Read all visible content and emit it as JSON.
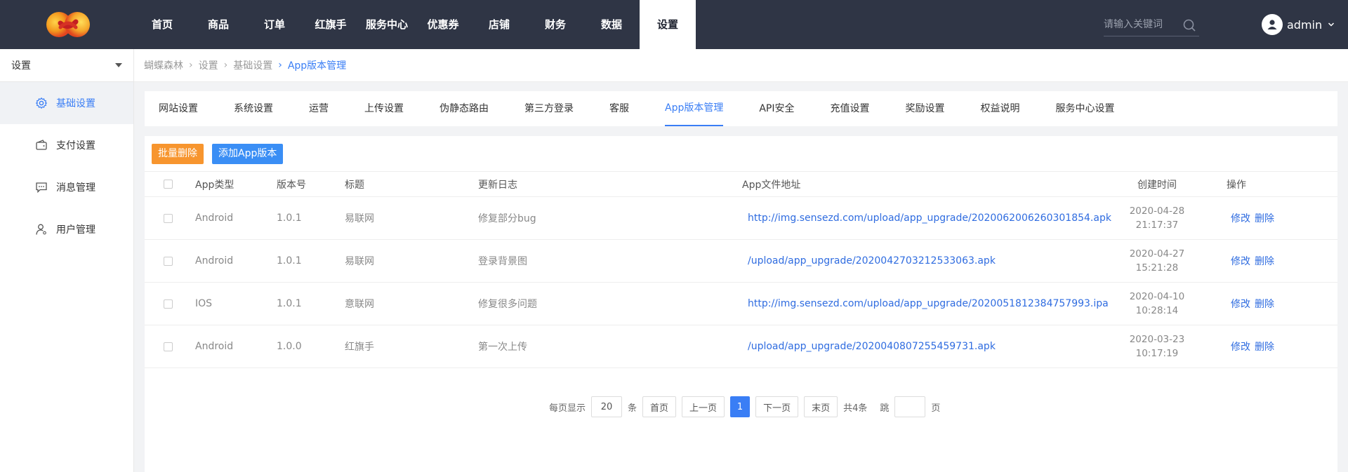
{
  "header": {
    "nav": [
      "首页",
      "商品",
      "订单",
      "红旗手",
      "服务中心",
      "优惠券",
      "店铺",
      "财务",
      "数据",
      "设置"
    ],
    "active_nav": "设置",
    "search_placeholder": "请输入关键词",
    "username": "admin"
  },
  "sidebar": {
    "select_label": "设置",
    "items": [
      {
        "label": "基础设置",
        "icon": "gear-icon",
        "active": true
      },
      {
        "label": "支付设置",
        "icon": "wallet-icon"
      },
      {
        "label": "消息管理",
        "icon": "message-icon"
      },
      {
        "label": "用户管理",
        "icon": "user-icon"
      }
    ]
  },
  "breadcrumb": [
    "蝴蝶森林",
    "设置",
    "基础设置",
    "App版本管理"
  ],
  "tabs": [
    "网站设置",
    "系统设置",
    "运营",
    "上传设置",
    "伪静态路由",
    "第三方登录",
    "客服",
    "App版本管理",
    "API安全",
    "充值设置",
    "奖励设置",
    "权益说明",
    "服务中心设置"
  ],
  "active_tab": "App版本管理",
  "toolbar": {
    "batch_delete": "批量删除",
    "add_version": "添加App版本"
  },
  "table": {
    "headers": [
      "App类型",
      "版本号",
      "标题",
      "更新日志",
      "App文件地址",
      "创建时间",
      "操作"
    ],
    "rows": [
      {
        "type": "Android",
        "version": "1.0.1",
        "title": "易联网",
        "log": "修复部分bug",
        "url": "http://img.sensezd.com/upload/app_upgrade/2020062006260301854.apk",
        "date": "2020-04-28",
        "time": "21:17:37"
      },
      {
        "type": "Android",
        "version": "1.0.1",
        "title": "易联网",
        "log": "登录背景图",
        "url": "/upload/app_upgrade/2020042703212533063.apk",
        "date": "2020-04-27",
        "time": "15:21:28"
      },
      {
        "type": "IOS",
        "version": "1.0.1",
        "title": "意联网",
        "log": "修复很多问题",
        "url": "http://img.sensezd.com/upload/app_upgrade/2020051812384757993.ipa",
        "date": "2020-04-10",
        "time": "10:28:14"
      },
      {
        "type": "Android",
        "version": "1.0.0",
        "title": "红旗手",
        "log": "第一次上传",
        "url": "/upload/app_upgrade/2020040807255459731.apk",
        "date": "2020-03-23",
        "time": "10:17:19"
      }
    ],
    "edit_label": "修改",
    "delete_label": "删除"
  },
  "pagination": {
    "per_page_label": "每页显示",
    "per_page_value": "20",
    "per_page_unit": "条",
    "first": "首页",
    "prev": "上一页",
    "current": "1",
    "next": "下一页",
    "last": "末页",
    "total": "共4条",
    "jump_label": "跳",
    "page_unit": "页"
  },
  "colors": {
    "topbar": "#2f3545",
    "accent": "#3a7ef5",
    "orange": "#f7952e"
  }
}
